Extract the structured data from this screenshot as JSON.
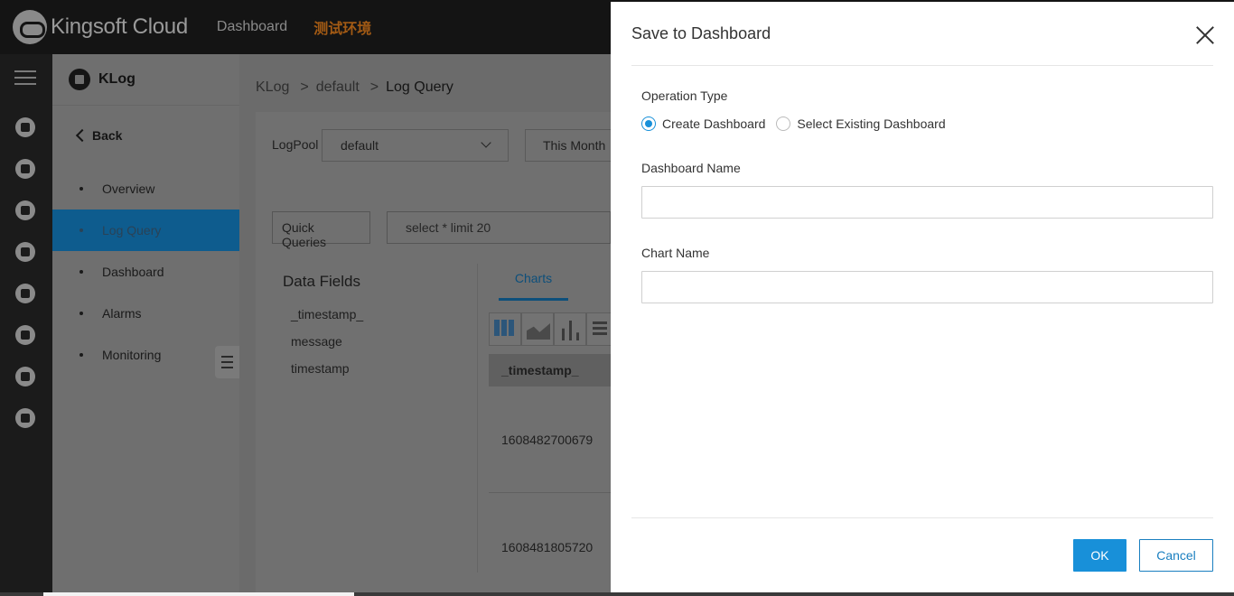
{
  "topbar": {
    "brand": "Kingsoft Cloud",
    "nav_dashboard": "Dashboard",
    "environment": "测试环境",
    "icons": [
      "cloud-logo-icon"
    ]
  },
  "rail": {
    "icons": [
      "menu-icon",
      "database-icon",
      "cloud-storage-icon",
      "network-icon",
      "server-icon",
      "monitor-icon",
      "wave-icon",
      "cloud-upload-icon",
      "id-card-icon"
    ]
  },
  "sidebar": {
    "product": "KLog",
    "back_label": "Back",
    "items": [
      {
        "label": "Overview",
        "active": false
      },
      {
        "label": "Log Query",
        "active": true
      },
      {
        "label": "Dashboard",
        "active": false
      },
      {
        "label": "Alarms",
        "active": false
      },
      {
        "label": "Monitoring",
        "active": false
      }
    ]
  },
  "breadcrumb": [
    "KLog",
    "default",
    "Log Query"
  ],
  "breadcrumb_sep": ">",
  "query_panel": {
    "logpool_label": "LogPool",
    "logpool_value": "default",
    "time_range": "This Month",
    "quick_queries": "Quick Queries",
    "query_text": "select * limit 20"
  },
  "data_fields": {
    "title": "Data Fields",
    "fields": [
      "_timestamp_",
      "message",
      "timestamp"
    ]
  },
  "results": {
    "tab": "Charts",
    "chart_types": [
      "table-chart-icon",
      "area-chart-icon",
      "bar-chart-icon",
      "horizontal-bar-chart-icon"
    ],
    "column_header": "_timestamp_",
    "rows": [
      "1608482700679",
      "1608481805720"
    ]
  },
  "drawer": {
    "title": "Save to Dashboard",
    "operation_type_label": "Operation Type",
    "option_create": "Create Dashboard",
    "option_existing": "Select Existing Dashboard",
    "selected_option": "Create Dashboard",
    "dashboard_name_label": "Dashboard Name",
    "dashboard_name_value": "",
    "chart_name_label": "Chart Name",
    "chart_name_value": "",
    "ok_label": "OK",
    "cancel_label": "Cancel"
  },
  "colors": {
    "accent": "#1890d9",
    "env_label": "#a25a14",
    "topbar_bg": "#141414"
  }
}
